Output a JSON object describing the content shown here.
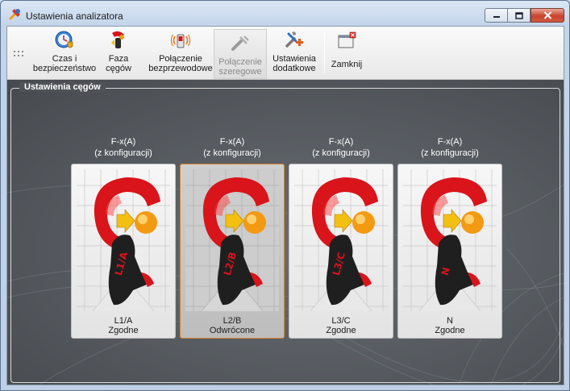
{
  "window": {
    "title": "Ustawienia analizatora"
  },
  "toolbar": {
    "items": [
      {
        "label": "Czas i\nbezpieczeństwo",
        "icon": "clock-shield-icon",
        "enabled": true
      },
      {
        "label": "Faza\ncęgów",
        "icon": "phase-clamps-icon",
        "enabled": true
      },
      {
        "label": "Połączenie\nbezprzewodowe",
        "icon": "wireless-icon",
        "enabled": true
      },
      {
        "label": "Połączenie\nszeregowe",
        "icon": "serial-connection-icon",
        "enabled": false
      },
      {
        "label": "Ustawienia\ndodatkowe",
        "icon": "tools-plus-icon",
        "enabled": true
      },
      {
        "label": "Zamknij",
        "icon": "close-window-icon",
        "enabled": true
      }
    ]
  },
  "group": {
    "title": "Ustawienia cęgów"
  },
  "clamps": [
    {
      "caption_line1": "F-x(A)",
      "caption_line2": "(z konfiguracji)",
      "phase": "L1/A",
      "status": "Zgodne",
      "tag": "L1/A",
      "selected": false
    },
    {
      "caption_line1": "F-x(A)",
      "caption_line2": "(z konfiguracji)",
      "phase": "L2/B",
      "status": "Odwrócone",
      "tag": "L2/B",
      "selected": true
    },
    {
      "caption_line1": "F-x(A)",
      "caption_line2": "(z konfiguracji)",
      "phase": "L3/C",
      "status": "Zgodne",
      "tag": "L3/C",
      "selected": false
    },
    {
      "caption_line1": "F-x(A)",
      "caption_line2": "(z konfiguracji)",
      "phase": "N",
      "status": "Zgodne",
      "tag": "N",
      "selected": false
    }
  ],
  "colors": {
    "clamp_red": "#d9141a",
    "knob_orange": "#f39a12",
    "handle_dark": "#222222",
    "selected_border": "#d8842f",
    "panel_bg": "#4f5358"
  }
}
